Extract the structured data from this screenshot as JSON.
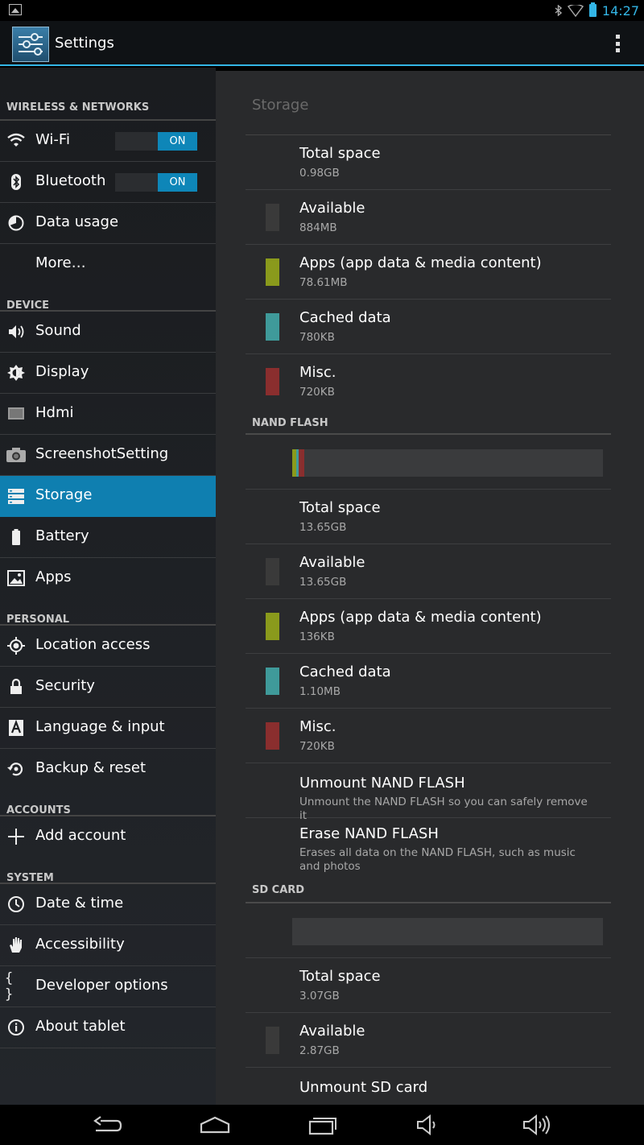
{
  "status_bar": {
    "time": "14:27",
    "icons": [
      "gallery-notification-icon",
      "bluetooth-icon",
      "wifi-icon",
      "battery-icon"
    ]
  },
  "action_bar": {
    "title": "Settings",
    "app_icon": "settings-sliders-icon",
    "overflow_icon": "overflow-menu-icon"
  },
  "sidebar": {
    "sections": [
      {
        "header": "WIRELESS & NETWORKS",
        "items": [
          {
            "label": "Wi-Fi",
            "icon": "wifi-icon",
            "toggle": "ON"
          },
          {
            "label": "Bluetooth",
            "icon": "bluetooth-icon",
            "toggle": "ON"
          },
          {
            "label": "Data usage",
            "icon": "data-usage-icon"
          },
          {
            "label": "More…",
            "icon": ""
          }
        ]
      },
      {
        "header": "DEVICE",
        "items": [
          {
            "label": "Sound",
            "icon": "speaker-icon"
          },
          {
            "label": "Display",
            "icon": "brightness-icon"
          },
          {
            "label": "Hdmi",
            "icon": "monitor-icon"
          },
          {
            "label": "ScreenshotSetting",
            "icon": "camera-icon"
          },
          {
            "label": "Storage",
            "icon": "storage-icon",
            "selected": true
          },
          {
            "label": "Battery",
            "icon": "battery-icon"
          },
          {
            "label": "Apps",
            "icon": "apps-icon"
          }
        ]
      },
      {
        "header": "PERSONAL",
        "items": [
          {
            "label": "Location access",
            "icon": "location-icon"
          },
          {
            "label": "Security",
            "icon": "lock-icon"
          },
          {
            "label": "Language & input",
            "icon": "keyboard-a-icon"
          },
          {
            "label": "Backup & reset",
            "icon": "backup-icon"
          }
        ]
      },
      {
        "header": "ACCOUNTS",
        "items": [
          {
            "label": "Add account",
            "icon": "plus-icon"
          }
        ]
      },
      {
        "header": "SYSTEM",
        "items": [
          {
            "label": "Date & time",
            "icon": "clock-icon"
          },
          {
            "label": "Accessibility",
            "icon": "hand-icon"
          },
          {
            "label": "Developer options",
            "icon": "braces-icon"
          },
          {
            "label": "About tablet",
            "icon": "info-icon"
          }
        ]
      }
    ]
  },
  "storage": {
    "title": "Storage",
    "colors": {
      "available": "#3a3a3a",
      "apps": "#8a9a1c",
      "cached": "#3f9a9a",
      "misc": "#8a2e2e"
    },
    "internal": {
      "rows": [
        {
          "name": "Total space",
          "value": "0.98GB",
          "color": ""
        },
        {
          "name": "Available",
          "value": "884MB",
          "color": "available"
        },
        {
          "name": "Apps (app data & media content)",
          "value": "78.61MB",
          "color": "apps"
        },
        {
          "name": "Cached data",
          "value": "780KB",
          "color": "cached"
        },
        {
          "name": "Misc.",
          "value": "720KB",
          "color": "misc"
        }
      ]
    },
    "nand": {
      "header": "NAND FLASH",
      "usage_bar_fractions": {
        "apps": 0.012,
        "cached": 0.01,
        "misc": 0.016
      },
      "rows": [
        {
          "name": "Total space",
          "value": "13.65GB",
          "color": ""
        },
        {
          "name": "Available",
          "value": "13.65GB",
          "color": "available"
        },
        {
          "name": "Apps (app data & media content)",
          "value": "136KB",
          "color": "apps"
        },
        {
          "name": "Cached data",
          "value": "1.10MB",
          "color": "cached"
        },
        {
          "name": "Misc.",
          "value": "720KB",
          "color": "misc"
        }
      ],
      "unmount": {
        "title": "Unmount NAND FLASH",
        "summary": "Unmount the NAND FLASH so you can safely remove it"
      },
      "erase": {
        "title": "Erase NAND FLASH",
        "summary": "Erases all data on the NAND FLASH, such as music and photos"
      }
    },
    "sd": {
      "header": "SD CARD",
      "rows": [
        {
          "name": "Total space",
          "value": "3.07GB",
          "color": ""
        },
        {
          "name": "Available",
          "value": "2.87GB",
          "color": "available"
        }
      ],
      "unmount": {
        "title": "Unmount SD card"
      }
    }
  },
  "nav_bar": {
    "buttons": [
      "back-icon",
      "home-icon",
      "recents-icon",
      "volume-down-icon",
      "volume-up-icon"
    ]
  }
}
